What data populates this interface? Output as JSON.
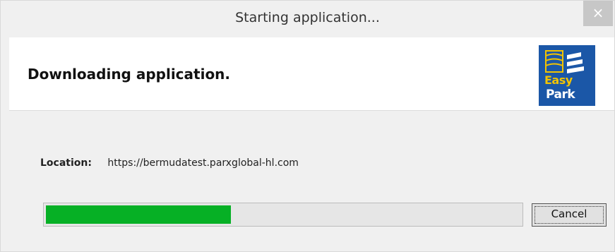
{
  "window": {
    "title": "Starting application...",
    "close_glyph": "×"
  },
  "header": {
    "heading": "Downloading application.",
    "logo": {
      "icon": "easy-park-logo",
      "line1": "Easy",
      "line2": "Park",
      "bg_color": "#1b57a7",
      "accent_color": "#f2c300"
    }
  },
  "location": {
    "label": "Location:",
    "value": "https://bermudatest.parxglobal-hl.com"
  },
  "progress": {
    "fraction": 0.39,
    "fill_color": "#06b025"
  },
  "buttons": {
    "cancel_label": "Cancel"
  }
}
